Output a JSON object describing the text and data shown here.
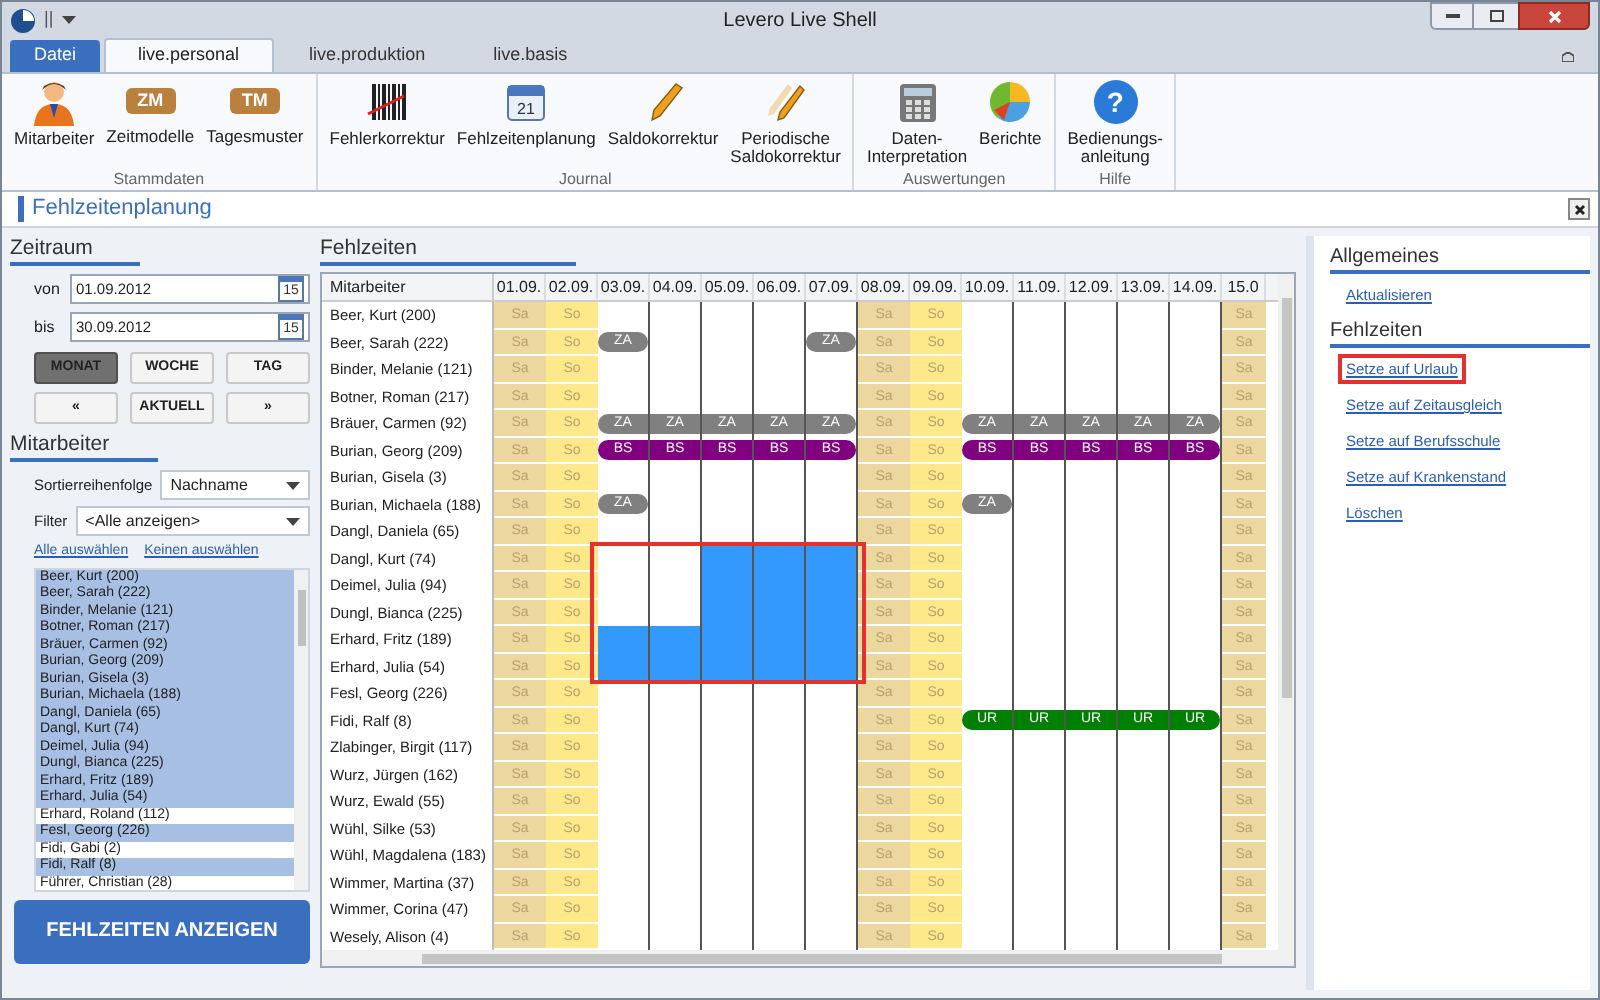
{
  "window": {
    "title": "Levero Live Shell",
    "quick_access": "||"
  },
  "tabs": [
    {
      "label": "Datei",
      "kind": "file",
      "selected": false
    },
    {
      "label": "live.personal",
      "kind": "tab",
      "selected": true
    },
    {
      "label": "live.produktion",
      "kind": "tab",
      "selected": false
    },
    {
      "label": "live.basis",
      "kind": "tab",
      "selected": false
    }
  ],
  "ribbon": [
    {
      "group": "Stammdaten",
      "buttons": [
        {
          "label": "Mitarbeiter",
          "kind": "person"
        },
        {
          "label": "Zeitmodelle",
          "kind": "badge",
          "badge": "ZM"
        },
        {
          "label": "Tagesmuster",
          "kind": "badge",
          "badge": "TM"
        }
      ]
    },
    {
      "group": "Journal",
      "buttons": [
        {
          "label": "Fehlerkorrektur",
          "kind": "barcode"
        },
        {
          "label": "Fehlzeitenplanung",
          "kind": "calendar",
          "badge": "21"
        },
        {
          "label": "Saldokorrektur",
          "kind": "pencil"
        },
        {
          "label": "Periodische\nSaldokorrektur",
          "kind": "pencils"
        }
      ]
    },
    {
      "group": "Auswertungen",
      "buttons": [
        {
          "label": "Daten-\nInterpretation",
          "kind": "calculator"
        },
        {
          "label": "Berichte",
          "kind": "pie"
        }
      ]
    },
    {
      "group": "Hilfe",
      "buttons": [
        {
          "label": "Bedienungs-\nanleitung",
          "kind": "help",
          "badge": "?"
        }
      ]
    }
  ],
  "view_title": "Fehlzeitenplanung",
  "left": {
    "zeitraum_title": "Zeitraum",
    "from_label": "von",
    "from_value": "01.09.2012",
    "to_label": "bis",
    "to_value": "30.09.2012",
    "from_calendar_badge": "15",
    "to_calendar_badge": "15",
    "range_buttons": [
      {
        "label": "MONAT",
        "selected": true
      },
      {
        "label": "WOCHE",
        "selected": false
      },
      {
        "label": "TAG",
        "selected": false
      }
    ],
    "nav_buttons": [
      "«",
      "AKTUELL",
      "»"
    ],
    "mitarbeiter_title": "Mitarbeiter",
    "sort_label": "Sortierreihenfolge",
    "sort_value": "Nachname",
    "filter_label": "Filter",
    "filter_value": "<Alle anzeigen>",
    "links": [
      "Alle auswählen",
      "Keinen auswählen"
    ],
    "employees": [
      {
        "name": "Beer, Kurt (200)",
        "selected": true
      },
      {
        "name": "Beer, Sarah (222)",
        "selected": true
      },
      {
        "name": "Binder, Melanie (121)",
        "selected": true
      },
      {
        "name": "Botner, Roman (217)",
        "selected": true
      },
      {
        "name": "Bräuer, Carmen (92)",
        "selected": true
      },
      {
        "name": "Burian, Georg (209)",
        "selected": true
      },
      {
        "name": "Burian, Gisela (3)",
        "selected": true
      },
      {
        "name": "Burian, Michaela (188)",
        "selected": true
      },
      {
        "name": "Dangl, Daniela (65)",
        "selected": true
      },
      {
        "name": "Dangl, Kurt (74)",
        "selected": true
      },
      {
        "name": "Deimel, Julia (94)",
        "selected": true
      },
      {
        "name": "Dungl, Bianca (225)",
        "selected": true
      },
      {
        "name": "Erhard, Fritz (189)",
        "selected": true
      },
      {
        "name": "Erhard, Julia (54)",
        "selected": true
      },
      {
        "name": "Erhard, Roland (112)",
        "selected": false
      },
      {
        "name": "Fesl, Georg (226)",
        "selected": true
      },
      {
        "name": "Fidi, Gabi (2)",
        "selected": false
      },
      {
        "name": "Fidi, Ralf (8)",
        "selected": true
      },
      {
        "name": "Führer, Christian (28)",
        "selected": false
      }
    ],
    "show_button": "FEHLZEITEN ANZEIGEN"
  },
  "grid": {
    "title": "Fehlzeiten",
    "name_header": "Mitarbeiter",
    "columns": [
      "01.09.",
      "02.09.",
      "03.09.",
      "04.09.",
      "05.09.",
      "06.09.",
      "07.09.",
      "08.09.",
      "09.09.",
      "10.09.",
      "11.09.",
      "12.09.",
      "13.09.",
      "14.09.",
      "15.0"
    ],
    "rows": [
      {
        "name": "Beer, Kurt (200)",
        "cells": [
          {
            "kind": "sa",
            "text": "Sa"
          },
          {
            "kind": "so",
            "text": "So"
          },
          {
            "kind": "wd",
            "selected": false
          },
          {
            "kind": "wd",
            "selected": false
          },
          {
            "kind": "wd",
            "selected": false
          },
          {
            "kind": "wd",
            "selected": false
          },
          {
            "kind": "wd",
            "selected": false
          },
          {
            "kind": "sa",
            "text": "Sa"
          },
          {
            "kind": "so",
            "text": "So"
          },
          {
            "kind": "wd",
            "selected": false
          },
          {
            "kind": "wd",
            "selected": false
          },
          {
            "kind": "wd",
            "selected": false
          },
          {
            "kind": "wd",
            "selected": false
          },
          {
            "kind": "wd",
            "selected": false
          },
          {
            "kind": "sa",
            "text": "Sa"
          }
        ]
      },
      {
        "name": "Beer, Sarah (222)",
        "cells": [
          {
            "kind": "sa",
            "text": "Sa"
          },
          {
            "kind": "so",
            "text": "So"
          },
          {
            "kind": "wd",
            "selected": false,
            "code": "ZA",
            "color": "#808080"
          },
          {
            "kind": "wd",
            "selected": false
          },
          {
            "kind": "wd",
            "selected": false
          },
          {
            "kind": "wd",
            "selected": false
          },
          {
            "kind": "wd",
            "selected": false,
            "code": "ZA",
            "color": "#808080"
          },
          {
            "kind": "sa",
            "text": "Sa"
          },
          {
            "kind": "so",
            "text": "So"
          },
          {
            "kind": "wd",
            "selected": false
          },
          {
            "kind": "wd",
            "selected": false
          },
          {
            "kind": "wd",
            "selected": false
          },
          {
            "kind": "wd",
            "selected": false
          },
          {
            "kind": "wd",
            "selected": false
          },
          {
            "kind": "sa",
            "text": "Sa"
          }
        ]
      },
      {
        "name": "Binder, Melanie (121)",
        "cells": [
          {
            "kind": "sa",
            "text": "Sa"
          },
          {
            "kind": "so",
            "text": "So"
          },
          {
            "kind": "wd",
            "selected": false
          },
          {
            "kind": "wd",
            "selected": false
          },
          {
            "kind": "wd",
            "selected": false
          },
          {
            "kind": "wd",
            "selected": false
          },
          {
            "kind": "wd",
            "selected": false
          },
          {
            "kind": "sa",
            "text": "Sa"
          },
          {
            "kind": "so",
            "text": "So"
          },
          {
            "kind": "wd",
            "selected": false
          },
          {
            "kind": "wd",
            "selected": false
          },
          {
            "kind": "wd",
            "selected": false
          },
          {
            "kind": "wd",
            "selected": false
          },
          {
            "kind": "wd",
            "selected": false
          },
          {
            "kind": "sa",
            "text": "Sa"
          }
        ]
      },
      {
        "name": "Botner, Roman (217)",
        "cells": [
          {
            "kind": "sa",
            "text": "Sa"
          },
          {
            "kind": "so",
            "text": "So"
          },
          {
            "kind": "wd",
            "selected": false
          },
          {
            "kind": "wd",
            "selected": false
          },
          {
            "kind": "wd",
            "selected": false
          },
          {
            "kind": "wd",
            "selected": false
          },
          {
            "kind": "wd",
            "selected": false
          },
          {
            "kind": "sa",
            "text": "Sa"
          },
          {
            "kind": "so",
            "text": "So"
          },
          {
            "kind": "wd",
            "selected": false
          },
          {
            "kind": "wd",
            "selected": false
          },
          {
            "kind": "wd",
            "selected": false
          },
          {
            "kind": "wd",
            "selected": false
          },
          {
            "kind": "wd",
            "selected": false
          },
          {
            "kind": "sa",
            "text": "Sa"
          }
        ]
      },
      {
        "name": "Bräuer, Carmen (92)",
        "cells": [
          {
            "kind": "sa",
            "text": "Sa"
          },
          {
            "kind": "so",
            "text": "So"
          },
          {
            "kind": "wd",
            "selected": false,
            "code": "ZA",
            "color": "#808080"
          },
          {
            "kind": "wd",
            "selected": false,
            "code": "ZA",
            "color": "#808080"
          },
          {
            "kind": "wd",
            "selected": false,
            "code": "ZA",
            "color": "#808080"
          },
          {
            "kind": "wd",
            "selected": false,
            "code": "ZA",
            "color": "#808080"
          },
          {
            "kind": "wd",
            "selected": false,
            "code": "ZA",
            "color": "#808080"
          },
          {
            "kind": "sa",
            "text": "Sa"
          },
          {
            "kind": "so",
            "text": "So"
          },
          {
            "kind": "wd",
            "selected": false,
            "code": "ZA",
            "color": "#808080"
          },
          {
            "kind": "wd",
            "selected": false,
            "code": "ZA",
            "color": "#808080"
          },
          {
            "kind": "wd",
            "selected": false,
            "code": "ZA",
            "color": "#808080"
          },
          {
            "kind": "wd",
            "selected": false,
            "code": "ZA",
            "color": "#808080"
          },
          {
            "kind": "wd",
            "selected": false,
            "code": "ZA",
            "color": "#808080"
          },
          {
            "kind": "sa",
            "text": "Sa"
          }
        ]
      },
      {
        "name": "Burian, Georg (209)",
        "cells": [
          {
            "kind": "sa",
            "text": "Sa"
          },
          {
            "kind": "so",
            "text": "So"
          },
          {
            "kind": "wd",
            "selected": false,
            "code": "BS",
            "color": "#800080"
          },
          {
            "kind": "wd",
            "selected": false,
            "code": "BS",
            "color": "#800080"
          },
          {
            "kind": "wd",
            "selected": false,
            "code": "BS",
            "color": "#800080"
          },
          {
            "kind": "wd",
            "selected": false,
            "code": "BS",
            "color": "#800080"
          },
          {
            "kind": "wd",
            "selected": false,
            "code": "BS",
            "color": "#800080"
          },
          {
            "kind": "sa",
            "text": "Sa"
          },
          {
            "kind": "so",
            "text": "So"
          },
          {
            "kind": "wd",
            "selected": false,
            "code": "BS",
            "color": "#800080"
          },
          {
            "kind": "wd",
            "selected": false,
            "code": "BS",
            "color": "#800080"
          },
          {
            "kind": "wd",
            "selected": false,
            "code": "BS",
            "color": "#800080"
          },
          {
            "kind": "wd",
            "selected": false,
            "code": "BS",
            "color": "#800080"
          },
          {
            "kind": "wd",
            "selected": false,
            "code": "BS",
            "color": "#800080"
          },
          {
            "kind": "sa",
            "text": "Sa"
          }
        ]
      },
      {
        "name": "Burian, Gisela (3)",
        "cells": [
          {
            "kind": "sa",
            "text": "Sa"
          },
          {
            "kind": "so",
            "text": "So"
          },
          {
            "kind": "wd",
            "selected": false
          },
          {
            "kind": "wd",
            "selected": false
          },
          {
            "kind": "wd",
            "selected": false
          },
          {
            "kind": "wd",
            "selected": false
          },
          {
            "kind": "wd",
            "selected": false
          },
          {
            "kind": "sa",
            "text": "Sa"
          },
          {
            "kind": "so",
            "text": "So"
          },
          {
            "kind": "wd",
            "selected": false
          },
          {
            "kind": "wd",
            "selected": false
          },
          {
            "kind": "wd",
            "selected": false
          },
          {
            "kind": "wd",
            "selected": false
          },
          {
            "kind": "wd",
            "selected": false
          },
          {
            "kind": "sa",
            "text": "Sa"
          }
        ]
      },
      {
        "name": "Burian, Michaela (188)",
        "cells": [
          {
            "kind": "sa",
            "text": "Sa"
          },
          {
            "kind": "so",
            "text": "So"
          },
          {
            "kind": "wd",
            "selected": false,
            "code": "ZA",
            "color": "#808080"
          },
          {
            "kind": "wd",
            "selected": false
          },
          {
            "kind": "wd",
            "selected": false
          },
          {
            "kind": "wd",
            "selected": false
          },
          {
            "kind": "wd",
            "selected": false
          },
          {
            "kind": "sa",
            "text": "Sa"
          },
          {
            "kind": "so",
            "text": "So"
          },
          {
            "kind": "wd",
            "selected": false,
            "code": "ZA",
            "color": "#808080"
          },
          {
            "kind": "wd",
            "selected": false
          },
          {
            "kind": "wd",
            "selected": false
          },
          {
            "kind": "wd",
            "selected": false
          },
          {
            "kind": "wd",
            "selected": false
          },
          {
            "kind": "sa",
            "text": "Sa"
          }
        ]
      },
      {
        "name": "Dangl, Daniela (65)",
        "cells": [
          {
            "kind": "sa",
            "text": "Sa"
          },
          {
            "kind": "so",
            "text": "So"
          },
          {
            "kind": "wd",
            "selected": false
          },
          {
            "kind": "wd",
            "selected": false
          },
          {
            "kind": "wd",
            "selected": false
          },
          {
            "kind": "wd",
            "selected": false
          },
          {
            "kind": "wd",
            "selected": false
          },
          {
            "kind": "sa",
            "text": "Sa"
          },
          {
            "kind": "so",
            "text": "So"
          },
          {
            "kind": "wd",
            "selected": false
          },
          {
            "kind": "wd",
            "selected": false
          },
          {
            "kind": "wd",
            "selected": false
          },
          {
            "kind": "wd",
            "selected": false
          },
          {
            "kind": "wd",
            "selected": false
          },
          {
            "kind": "sa",
            "text": "Sa"
          }
        ]
      },
      {
        "name": "Dangl, Kurt (74)",
        "cells": [
          {
            "kind": "sa",
            "text": "Sa"
          },
          {
            "kind": "so",
            "text": "So"
          },
          {
            "kind": "wd",
            "selected": false
          },
          {
            "kind": "wd",
            "selected": false
          },
          {
            "kind": "wd",
            "selected": true
          },
          {
            "kind": "wd",
            "selected": true
          },
          {
            "kind": "wd",
            "selected": true
          },
          {
            "kind": "sa",
            "text": "Sa"
          },
          {
            "kind": "so",
            "text": "So"
          },
          {
            "kind": "wd",
            "selected": false
          },
          {
            "kind": "wd",
            "selected": false
          },
          {
            "kind": "wd",
            "selected": false
          },
          {
            "kind": "wd",
            "selected": false
          },
          {
            "kind": "wd",
            "selected": false
          },
          {
            "kind": "sa",
            "text": "Sa"
          }
        ]
      },
      {
        "name": "Deimel, Julia (94)",
        "cells": [
          {
            "kind": "sa",
            "text": "Sa"
          },
          {
            "kind": "so",
            "text": "So"
          },
          {
            "kind": "wd",
            "selected": false
          },
          {
            "kind": "wd",
            "selected": false
          },
          {
            "kind": "wd",
            "selected": true
          },
          {
            "kind": "wd",
            "selected": true
          },
          {
            "kind": "wd",
            "selected": true
          },
          {
            "kind": "sa",
            "text": "Sa"
          },
          {
            "kind": "so",
            "text": "So"
          },
          {
            "kind": "wd",
            "selected": false
          },
          {
            "kind": "wd",
            "selected": false
          },
          {
            "kind": "wd",
            "selected": false
          },
          {
            "kind": "wd",
            "selected": false
          },
          {
            "kind": "wd",
            "selected": false
          },
          {
            "kind": "sa",
            "text": "Sa"
          }
        ]
      },
      {
        "name": "Dungl, Bianca (225)",
        "cells": [
          {
            "kind": "sa",
            "text": "Sa"
          },
          {
            "kind": "so",
            "text": "So"
          },
          {
            "kind": "wd",
            "selected": false
          },
          {
            "kind": "wd",
            "selected": false
          },
          {
            "kind": "wd",
            "selected": true
          },
          {
            "kind": "wd",
            "selected": true
          },
          {
            "kind": "wd",
            "selected": true
          },
          {
            "kind": "sa",
            "text": "Sa"
          },
          {
            "kind": "so",
            "text": "So"
          },
          {
            "kind": "wd",
            "selected": false
          },
          {
            "kind": "wd",
            "selected": false
          },
          {
            "kind": "wd",
            "selected": false
          },
          {
            "kind": "wd",
            "selected": false
          },
          {
            "kind": "wd",
            "selected": false
          },
          {
            "kind": "sa",
            "text": "Sa"
          }
        ]
      },
      {
        "name": "Erhard, Fritz (189)",
        "cells": [
          {
            "kind": "sa",
            "text": "Sa"
          },
          {
            "kind": "so",
            "text": "So"
          },
          {
            "kind": "wd",
            "selected": true
          },
          {
            "kind": "wd",
            "selected": true
          },
          {
            "kind": "wd",
            "selected": true
          },
          {
            "kind": "wd",
            "selected": true
          },
          {
            "kind": "wd",
            "selected": true
          },
          {
            "kind": "sa",
            "text": "Sa"
          },
          {
            "kind": "so",
            "text": "So"
          },
          {
            "kind": "wd",
            "selected": false
          },
          {
            "kind": "wd",
            "selected": false
          },
          {
            "kind": "wd",
            "selected": false
          },
          {
            "kind": "wd",
            "selected": false
          },
          {
            "kind": "wd",
            "selected": false
          },
          {
            "kind": "sa",
            "text": "Sa"
          }
        ]
      },
      {
        "name": "Erhard, Julia (54)",
        "cells": [
          {
            "kind": "sa",
            "text": "Sa"
          },
          {
            "kind": "so",
            "text": "So"
          },
          {
            "kind": "wd",
            "selected": true
          },
          {
            "kind": "wd",
            "selected": true
          },
          {
            "kind": "wd",
            "selected": true
          },
          {
            "kind": "wd",
            "selected": true
          },
          {
            "kind": "wd",
            "selected": true
          },
          {
            "kind": "sa",
            "text": "Sa"
          },
          {
            "kind": "so",
            "text": "So"
          },
          {
            "kind": "wd",
            "selected": false
          },
          {
            "kind": "wd",
            "selected": false
          },
          {
            "kind": "wd",
            "selected": false
          },
          {
            "kind": "wd",
            "selected": false
          },
          {
            "kind": "wd",
            "selected": false
          },
          {
            "kind": "sa",
            "text": "Sa"
          }
        ]
      },
      {
        "name": "Fesl, Georg (226)",
        "cells": [
          {
            "kind": "sa",
            "text": "Sa"
          },
          {
            "kind": "so",
            "text": "So"
          },
          {
            "kind": "wd",
            "selected": false
          },
          {
            "kind": "wd",
            "selected": false
          },
          {
            "kind": "wd",
            "selected": false
          },
          {
            "kind": "wd",
            "selected": false
          },
          {
            "kind": "wd",
            "selected": false
          },
          {
            "kind": "sa",
            "text": "Sa"
          },
          {
            "kind": "so",
            "text": "So"
          },
          {
            "kind": "wd",
            "selected": false
          },
          {
            "kind": "wd",
            "selected": false
          },
          {
            "kind": "wd",
            "selected": false
          },
          {
            "kind": "wd",
            "selected": false
          },
          {
            "kind": "wd",
            "selected": false
          },
          {
            "kind": "sa",
            "text": "Sa"
          }
        ]
      },
      {
        "name": "Fidi, Ralf (8)",
        "cells": [
          {
            "kind": "sa",
            "text": "Sa"
          },
          {
            "kind": "so",
            "text": "So"
          },
          {
            "kind": "wd",
            "selected": false
          },
          {
            "kind": "wd",
            "selected": false
          },
          {
            "kind": "wd",
            "selected": false
          },
          {
            "kind": "wd",
            "selected": false
          },
          {
            "kind": "wd",
            "selected": false
          },
          {
            "kind": "sa",
            "text": "Sa"
          },
          {
            "kind": "so",
            "text": "So"
          },
          {
            "kind": "wd",
            "selected": false,
            "code": "UR",
            "color": "#008000"
          },
          {
            "kind": "wd",
            "selected": false,
            "code": "UR",
            "color": "#008000"
          },
          {
            "kind": "wd",
            "selected": false,
            "code": "UR",
            "color": "#008000"
          },
          {
            "kind": "wd",
            "selected": false,
            "code": "UR",
            "color": "#008000"
          },
          {
            "kind": "wd",
            "selected": false,
            "code": "UR",
            "color": "#008000"
          },
          {
            "kind": "sa",
            "text": "Sa"
          }
        ]
      },
      {
        "name": "Zlabinger, Birgit (117)",
        "cells": [
          {
            "kind": "sa",
            "text": "Sa"
          },
          {
            "kind": "so",
            "text": "So"
          },
          {
            "kind": "wd",
            "selected": false
          },
          {
            "kind": "wd",
            "selected": false
          },
          {
            "kind": "wd",
            "selected": false
          },
          {
            "kind": "wd",
            "selected": false
          },
          {
            "kind": "wd",
            "selected": false
          },
          {
            "kind": "sa",
            "text": "Sa"
          },
          {
            "kind": "so",
            "text": "So"
          },
          {
            "kind": "wd",
            "selected": false
          },
          {
            "kind": "wd",
            "selected": false
          },
          {
            "kind": "wd",
            "selected": false
          },
          {
            "kind": "wd",
            "selected": false
          },
          {
            "kind": "wd",
            "selected": false
          },
          {
            "kind": "sa",
            "text": "Sa"
          }
        ]
      },
      {
        "name": "Wurz, Jürgen (162)",
        "cells": [
          {
            "kind": "sa",
            "text": "Sa"
          },
          {
            "kind": "so",
            "text": "So"
          },
          {
            "kind": "wd",
            "selected": false
          },
          {
            "kind": "wd",
            "selected": false
          },
          {
            "kind": "wd",
            "selected": false
          },
          {
            "kind": "wd",
            "selected": false
          },
          {
            "kind": "wd",
            "selected": false
          },
          {
            "kind": "sa",
            "text": "Sa"
          },
          {
            "kind": "so",
            "text": "So"
          },
          {
            "kind": "wd",
            "selected": false
          },
          {
            "kind": "wd",
            "selected": false
          },
          {
            "kind": "wd",
            "selected": false
          },
          {
            "kind": "wd",
            "selected": false
          },
          {
            "kind": "wd",
            "selected": false
          },
          {
            "kind": "sa",
            "text": "Sa"
          }
        ]
      },
      {
        "name": "Wurz, Ewald (55)",
        "cells": [
          {
            "kind": "sa",
            "text": "Sa"
          },
          {
            "kind": "so",
            "text": "So"
          },
          {
            "kind": "wd",
            "selected": false
          },
          {
            "kind": "wd",
            "selected": false
          },
          {
            "kind": "wd",
            "selected": false
          },
          {
            "kind": "wd",
            "selected": false
          },
          {
            "kind": "wd",
            "selected": false
          },
          {
            "kind": "sa",
            "text": "Sa"
          },
          {
            "kind": "so",
            "text": "So"
          },
          {
            "kind": "wd",
            "selected": false
          },
          {
            "kind": "wd",
            "selected": false
          },
          {
            "kind": "wd",
            "selected": false
          },
          {
            "kind": "wd",
            "selected": false
          },
          {
            "kind": "wd",
            "selected": false
          },
          {
            "kind": "sa",
            "text": "Sa"
          }
        ]
      },
      {
        "name": "Wühl, Silke (53)",
        "cells": [
          {
            "kind": "sa",
            "text": "Sa"
          },
          {
            "kind": "so",
            "text": "So"
          },
          {
            "kind": "wd",
            "selected": false
          },
          {
            "kind": "wd",
            "selected": false
          },
          {
            "kind": "wd",
            "selected": false
          },
          {
            "kind": "wd",
            "selected": false
          },
          {
            "kind": "wd",
            "selected": false
          },
          {
            "kind": "sa",
            "text": "Sa"
          },
          {
            "kind": "so",
            "text": "So"
          },
          {
            "kind": "wd",
            "selected": false
          },
          {
            "kind": "wd",
            "selected": false
          },
          {
            "kind": "wd",
            "selected": false
          },
          {
            "kind": "wd",
            "selected": false
          },
          {
            "kind": "wd",
            "selected": false
          },
          {
            "kind": "sa",
            "text": "Sa"
          }
        ]
      },
      {
        "name": "Wühl, Magdalena (183)",
        "cells": [
          {
            "kind": "sa",
            "text": "Sa"
          },
          {
            "kind": "so",
            "text": "So"
          },
          {
            "kind": "wd",
            "selected": false
          },
          {
            "kind": "wd",
            "selected": false
          },
          {
            "kind": "wd",
            "selected": false
          },
          {
            "kind": "wd",
            "selected": false
          },
          {
            "kind": "wd",
            "selected": false
          },
          {
            "kind": "sa",
            "text": "Sa"
          },
          {
            "kind": "so",
            "text": "So"
          },
          {
            "kind": "wd",
            "selected": false
          },
          {
            "kind": "wd",
            "selected": false
          },
          {
            "kind": "wd",
            "selected": false
          },
          {
            "kind": "wd",
            "selected": false
          },
          {
            "kind": "wd",
            "selected": false
          },
          {
            "kind": "sa",
            "text": "Sa"
          }
        ]
      },
      {
        "name": "Wimmer, Martina (37)",
        "cells": [
          {
            "kind": "sa",
            "text": "Sa"
          },
          {
            "kind": "so",
            "text": "So"
          },
          {
            "kind": "wd",
            "selected": false
          },
          {
            "kind": "wd",
            "selected": false
          },
          {
            "kind": "wd",
            "selected": false
          },
          {
            "kind": "wd",
            "selected": false
          },
          {
            "kind": "wd",
            "selected": false
          },
          {
            "kind": "sa",
            "text": "Sa"
          },
          {
            "kind": "so",
            "text": "So"
          },
          {
            "kind": "wd",
            "selected": false
          },
          {
            "kind": "wd",
            "selected": false
          },
          {
            "kind": "wd",
            "selected": false
          },
          {
            "kind": "wd",
            "selected": false
          },
          {
            "kind": "wd",
            "selected": false
          },
          {
            "kind": "sa",
            "text": "Sa"
          }
        ]
      },
      {
        "name": "Wimmer, Corina (47)",
        "cells": [
          {
            "kind": "sa",
            "text": "Sa"
          },
          {
            "kind": "so",
            "text": "So"
          },
          {
            "kind": "wd",
            "selected": false
          },
          {
            "kind": "wd",
            "selected": false
          },
          {
            "kind": "wd",
            "selected": false
          },
          {
            "kind": "wd",
            "selected": false
          },
          {
            "kind": "wd",
            "selected": false
          },
          {
            "kind": "sa",
            "text": "Sa"
          },
          {
            "kind": "so",
            "text": "So"
          },
          {
            "kind": "wd",
            "selected": false
          },
          {
            "kind": "wd",
            "selected": false
          },
          {
            "kind": "wd",
            "selected": false
          },
          {
            "kind": "wd",
            "selected": false
          },
          {
            "kind": "wd",
            "selected": false
          },
          {
            "kind": "sa",
            "text": "Sa"
          }
        ]
      },
      {
        "name": "Wesely, Alison (4)",
        "cells": [
          {
            "kind": "sa",
            "text": "Sa"
          },
          {
            "kind": "so",
            "text": "So"
          },
          {
            "kind": "wd",
            "selected": false
          },
          {
            "kind": "wd",
            "selected": false
          },
          {
            "kind": "wd",
            "selected": false
          },
          {
            "kind": "wd",
            "selected": false
          },
          {
            "kind": "wd",
            "selected": false
          },
          {
            "kind": "sa",
            "text": "Sa"
          },
          {
            "kind": "so",
            "text": "So"
          },
          {
            "kind": "wd",
            "selected": false
          },
          {
            "kind": "wd",
            "selected": false
          },
          {
            "kind": "wd",
            "selected": false
          },
          {
            "kind": "wd",
            "selected": false
          },
          {
            "kind": "wd",
            "selected": false
          },
          {
            "kind": "sa",
            "text": "Sa"
          }
        ]
      }
    ]
  },
  "right": {
    "sections": [
      {
        "title": "Allgemeines",
        "links": [
          {
            "label": "Aktualisieren",
            "highlighted": false
          }
        ]
      },
      {
        "title": "Fehlzeiten",
        "links": [
          {
            "label": "Setze auf Urlaub",
            "highlighted": true
          },
          {
            "label": "Setze auf Zeitausgleich",
            "highlighted": false
          },
          {
            "label": "Setze auf Berufsschule",
            "highlighted": false
          },
          {
            "label": "Setze auf Krankenstand",
            "highlighted": false
          },
          {
            "label": "Löschen",
            "highlighted": false
          }
        ]
      }
    ]
  }
}
